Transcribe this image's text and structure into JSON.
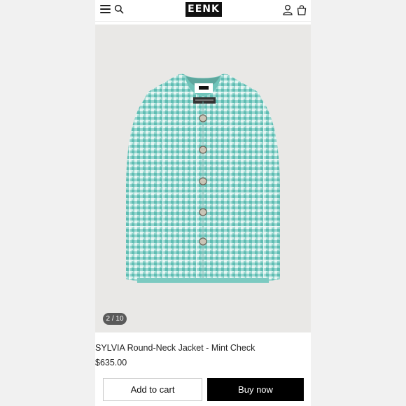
{
  "header": {
    "logo_text": "EENK",
    "menu_icon": "hamburger-menu-icon",
    "search_icon": "search-icon",
    "account_icon": "user-icon",
    "cart_icon": "shopping-bag-icon"
  },
  "gallery": {
    "counter": "2 / 10",
    "current": 2,
    "total": 10
  },
  "product": {
    "title": "SYLVIA Round-Neck Jacket - Mint Check",
    "price": "$635.00",
    "colors": {
      "jacket": "#8fd1ca",
      "background": "#e9e8e6"
    }
  },
  "actions": {
    "add_to_cart": "Add to cart",
    "buy_now": "Buy now"
  }
}
